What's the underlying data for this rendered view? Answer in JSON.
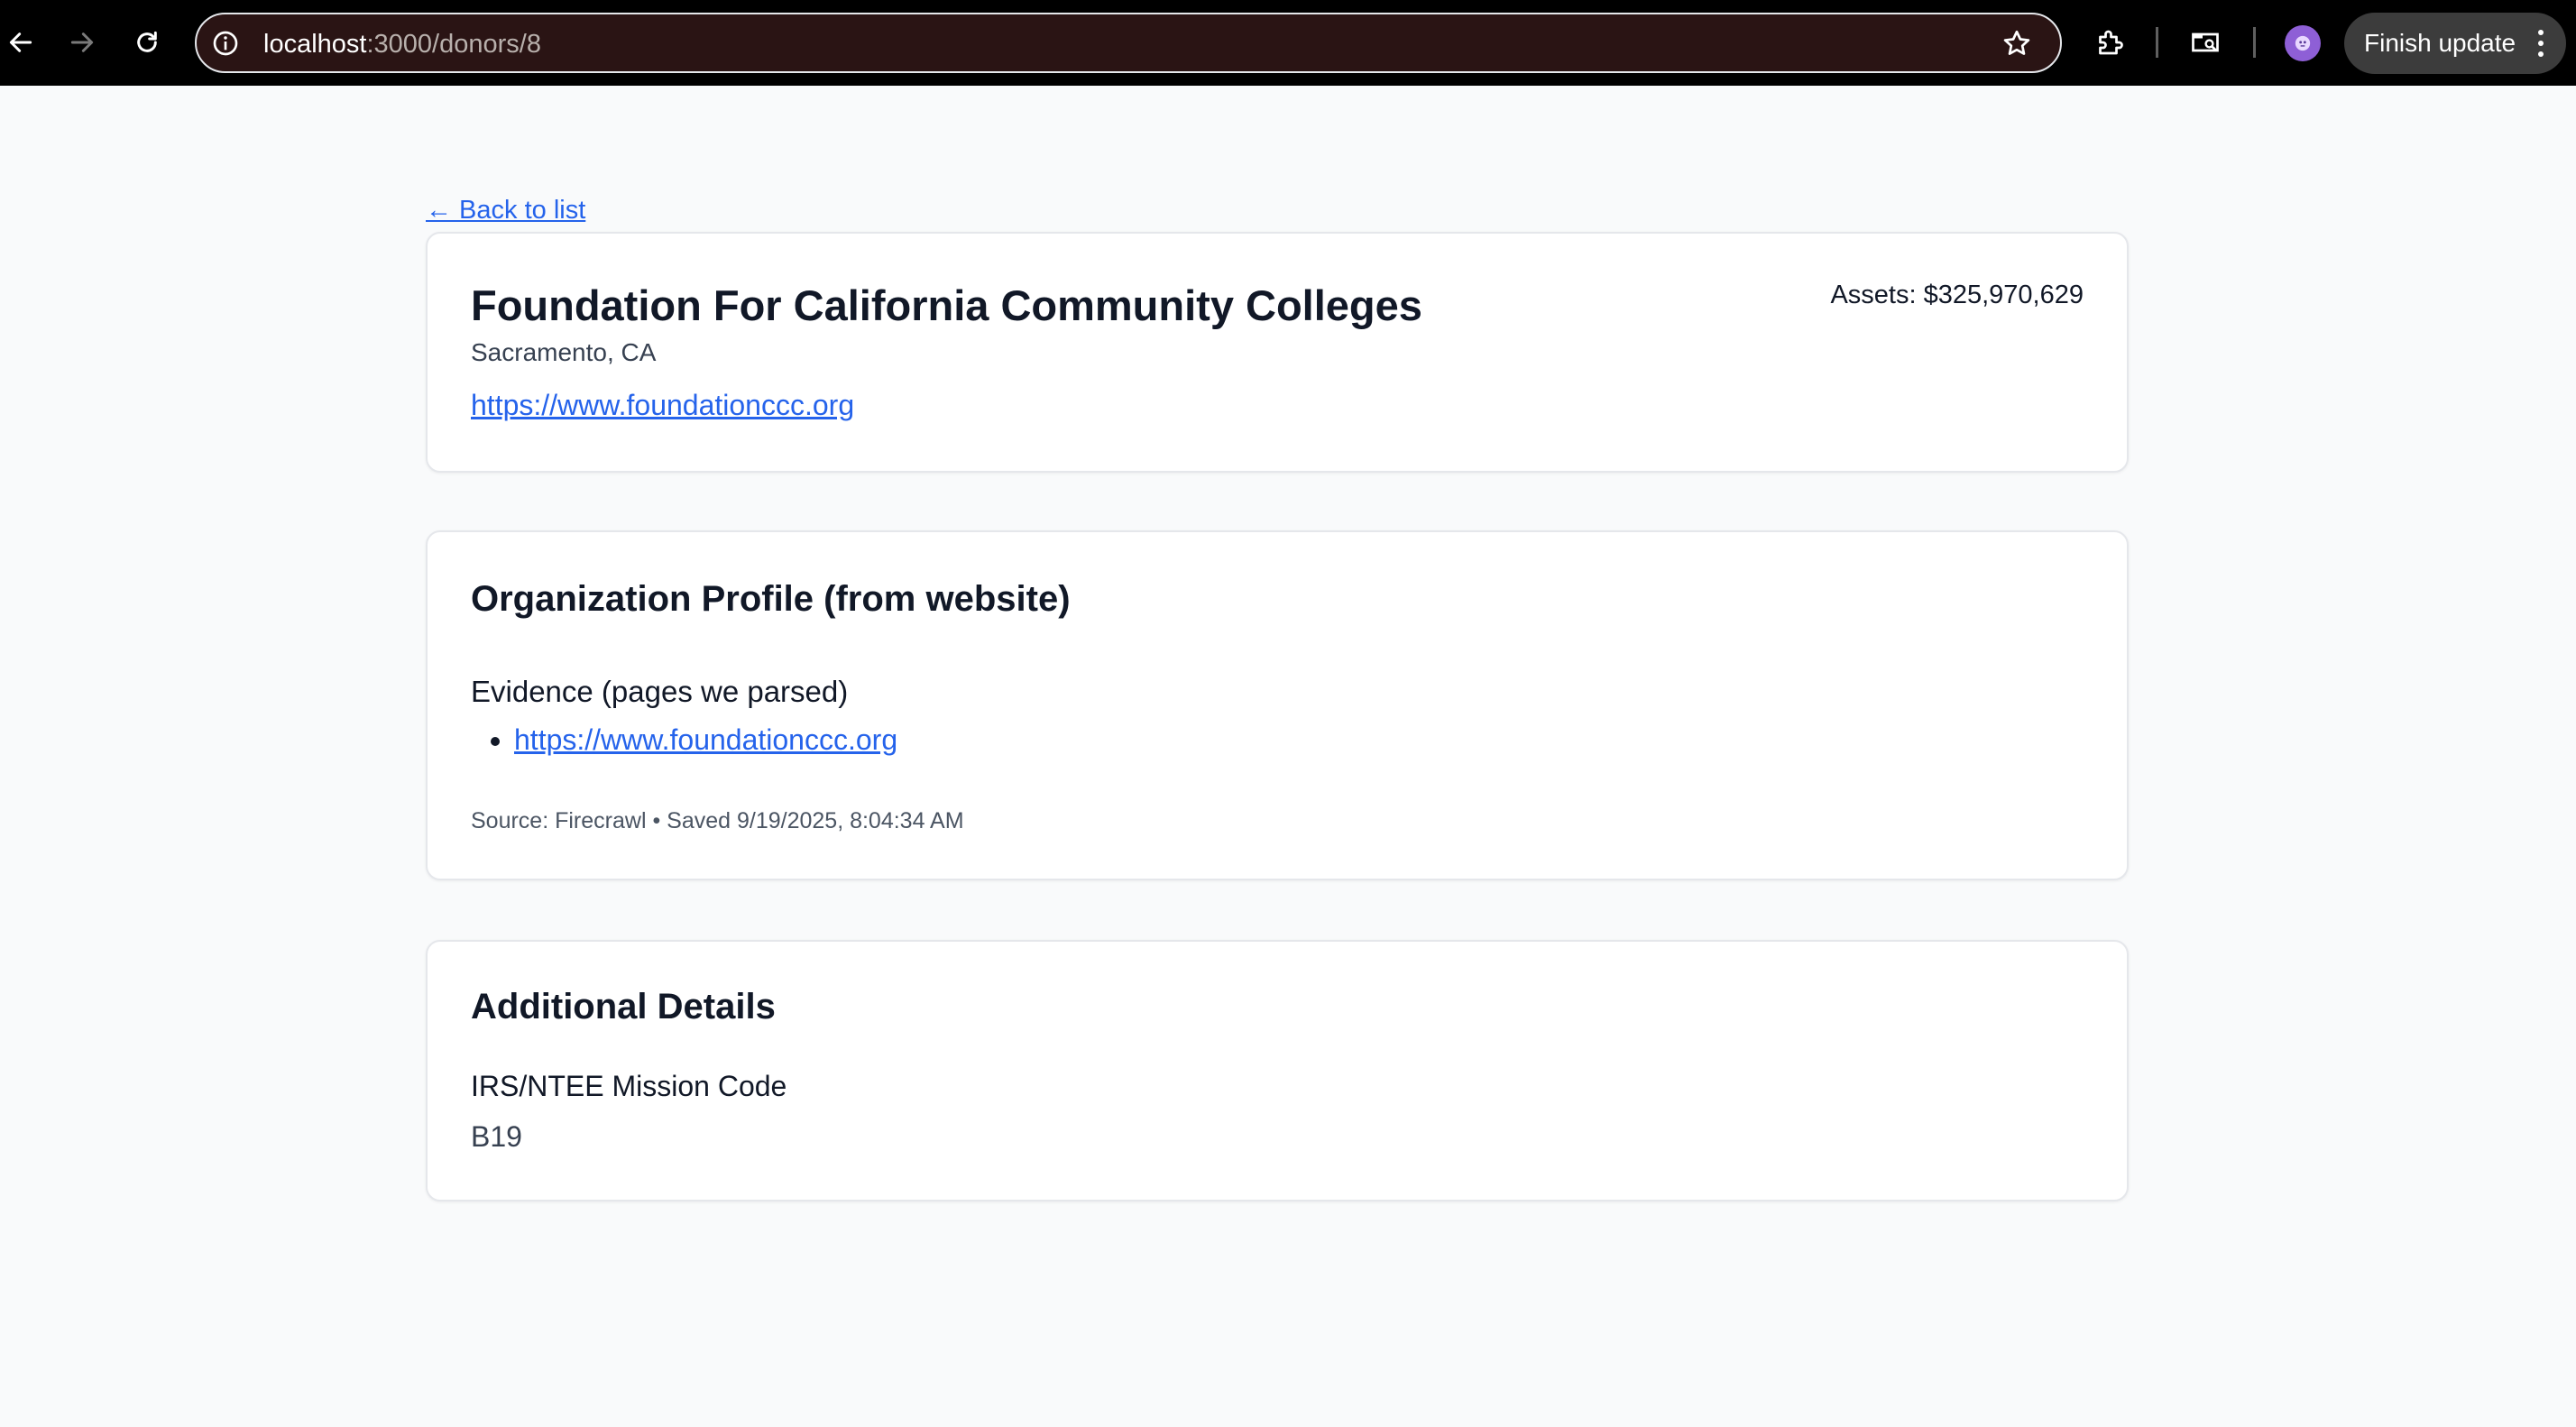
{
  "browser": {
    "url_host": "localhost",
    "url_path": ":3000/donors/8",
    "finish_update_label": "Finish update",
    "icons": [
      "back-arrow-icon",
      "forward-arrow-icon",
      "reload-icon",
      "info-icon",
      "star-icon",
      "extensions-icon",
      "tab-search-icon",
      "profile-avatar",
      "more-vert-icon"
    ]
  },
  "page": {
    "back_link": "← Back to list",
    "donor": {
      "name": "Foundation For California Community Colleges",
      "location": "Sacramento, CA",
      "website": "https://www.foundationccc.org",
      "assets": "Assets: $325,970,629"
    },
    "profile": {
      "title": "Organization Profile (from website)",
      "evidence_heading": "Evidence (pages we parsed)",
      "evidence_links": [
        "https://www.foundationccc.org"
      ],
      "source_line": "Source: Firecrawl • Saved 9/19/2025, 8:04:34 AM"
    },
    "details": {
      "title": "Additional Details",
      "mission_code_label": "IRS/NTEE Mission Code",
      "mission_code_value": "B19"
    }
  },
  "colors": {
    "link": "#2563eb",
    "page_bg": "#f9fafb",
    "card_border": "#e5e7eb",
    "toolbar_bg": "#000000",
    "avatar": "#8e5fd6"
  }
}
